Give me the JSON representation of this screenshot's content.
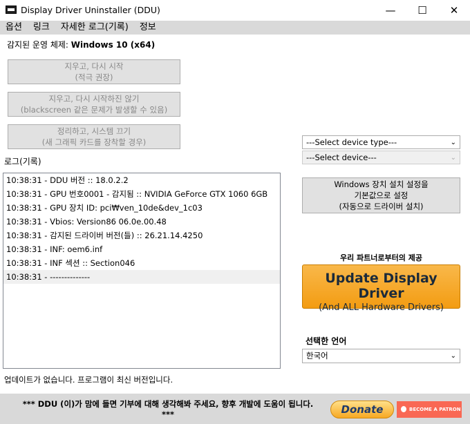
{
  "window": {
    "title": "Display Driver Uninstaller (DDU)",
    "min": "—",
    "max": "☐",
    "close": "✕"
  },
  "menu": [
    "옵션",
    "링크",
    "자세한 로그(기록)",
    "정보"
  ],
  "os": {
    "label": "감지된 운영 체제: ",
    "value": "Windows 10 (x64)"
  },
  "buttons": {
    "clean_restart": {
      "line1": "지우고, 다시 시작",
      "line2": "(적극 권장)"
    },
    "clean_no_restart": {
      "line1": "지우고, 다시 시작하진 않기",
      "line2": "(blackscreen 같은 문제가 발생할 수 있음)"
    },
    "clean_shutdown": {
      "line1": "정리하고, 시스템 끄기",
      "line2": "(새 그래픽 카드를 장착할 경우)"
    },
    "windows_default": {
      "line1": "Windows 장치 설치 설정을",
      "line2": "기본값으로 설정",
      "line3": "(자동으로 드라이버 설치)"
    }
  },
  "device_type": "---Select device type---",
  "device": "---Select device---",
  "log_label": "로그(기록)",
  "log": [
    "10:38:31 - DDU 버전 :: 18.0.2.2",
    "10:38:31 - GPU 번호0001 - 감지됨 :: NVIDIA GeForce GTX 1060 6GB",
    "10:38:31 - GPU 장치 ID: pci₩ven_10de&dev_1c03",
    "10:38:31 - Vbios: Version86 06.0e.00.48",
    "10:38:31 - 감지된 드라이버 버전(들) :: 26.21.14.4250",
    "10:38:31 - INF: oem6.inf",
    "10:38:31 - INF 섹션 :: Section046",
    "10:38:31 - --------------"
  ],
  "partner": "우리 파트너로부터의 제공",
  "update_ad": {
    "line1": "Update Display Driver",
    "line2": "(And ALL Hardware Drivers)"
  },
  "language_label": "선택한 언어",
  "language": "한국어",
  "status": "업데이트가 없습니다.  프로그램이 최신 버전입니다.",
  "footer": {
    "text": "*** DDU (이)가 맘에 들면 기부에 대해 생각해봐 주세요, 향후 개발에 도움이 됩니다.",
    "stars": "***",
    "donate": "Donate",
    "patron": "BECOME A PATRON"
  }
}
